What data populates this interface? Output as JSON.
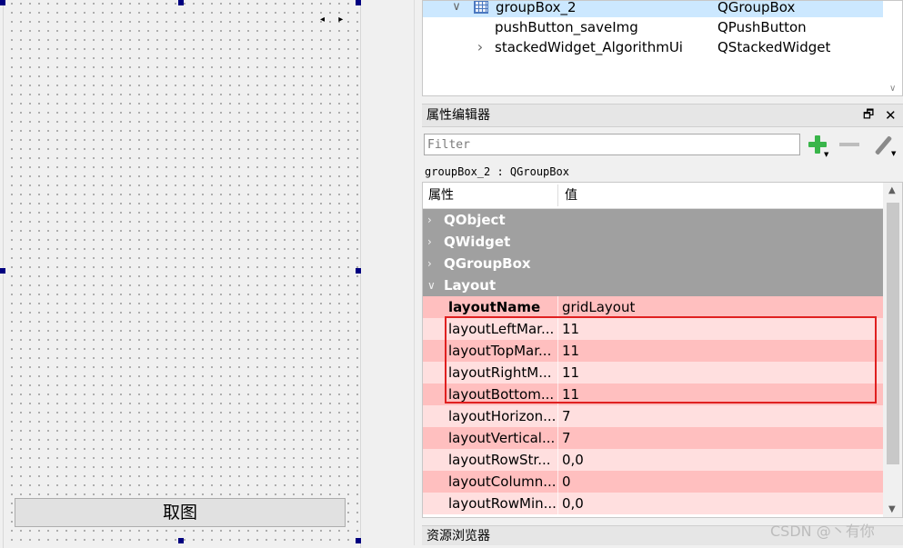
{
  "designer": {
    "capture_button_label": "取图",
    "scroll_arrows": "◂ ▸"
  },
  "object_tree": {
    "rows": [
      {
        "name": "groupBox_2",
        "class": "QGroupBox",
        "expander": "∨",
        "icon": "grid-layout-icon",
        "selected": true
      },
      {
        "name": "pushButton_saveImg",
        "class": "QPushButton",
        "expander": "",
        "selected": false
      },
      {
        "name": "stackedWidget_AlgorithmUi",
        "class": "QStackedWidget",
        "expander": "›",
        "selected": false
      }
    ]
  },
  "property_editor": {
    "title": "属性编辑器",
    "float_glyph": "🗗",
    "close_glyph": "✕",
    "filter_placeholder": "Filter",
    "object_label": "groupBox_2 : QGroupBox",
    "header": {
      "property": "属性",
      "value": "值"
    },
    "groups": [
      {
        "label": "QObject",
        "chevron": "›"
      },
      {
        "label": "QWidget",
        "chevron": "›"
      },
      {
        "label": "QGroupBox",
        "chevron": "›"
      },
      {
        "label": "Layout",
        "chevron": "∨"
      }
    ],
    "layout_properties": [
      {
        "name": "layoutName",
        "value": "gridLayout",
        "bold": true
      },
      {
        "name": "layoutLeftMar...",
        "value": "11"
      },
      {
        "name": "layoutTopMar...",
        "value": "11"
      },
      {
        "name": "layoutRightM...",
        "value": "11"
      },
      {
        "name": "layoutBottom...",
        "value": "11"
      },
      {
        "name": "layoutHorizon...",
        "value": "7"
      },
      {
        "name": "layoutVertical...",
        "value": "7"
      },
      {
        "name": "layoutRowStr...",
        "value": "0,0"
      },
      {
        "name": "layoutColumn...",
        "value": "0"
      },
      {
        "name": "layoutRowMin...",
        "value": "0,0"
      }
    ],
    "colors": {
      "group_bg": "#a0a0a0",
      "row_dark": "#ffbfbf",
      "row_light": "#ffdfdf",
      "highlight": "#e02020"
    }
  },
  "resource_browser": {
    "title": "资源浏览器"
  },
  "watermark": "CSDN @丶有你"
}
